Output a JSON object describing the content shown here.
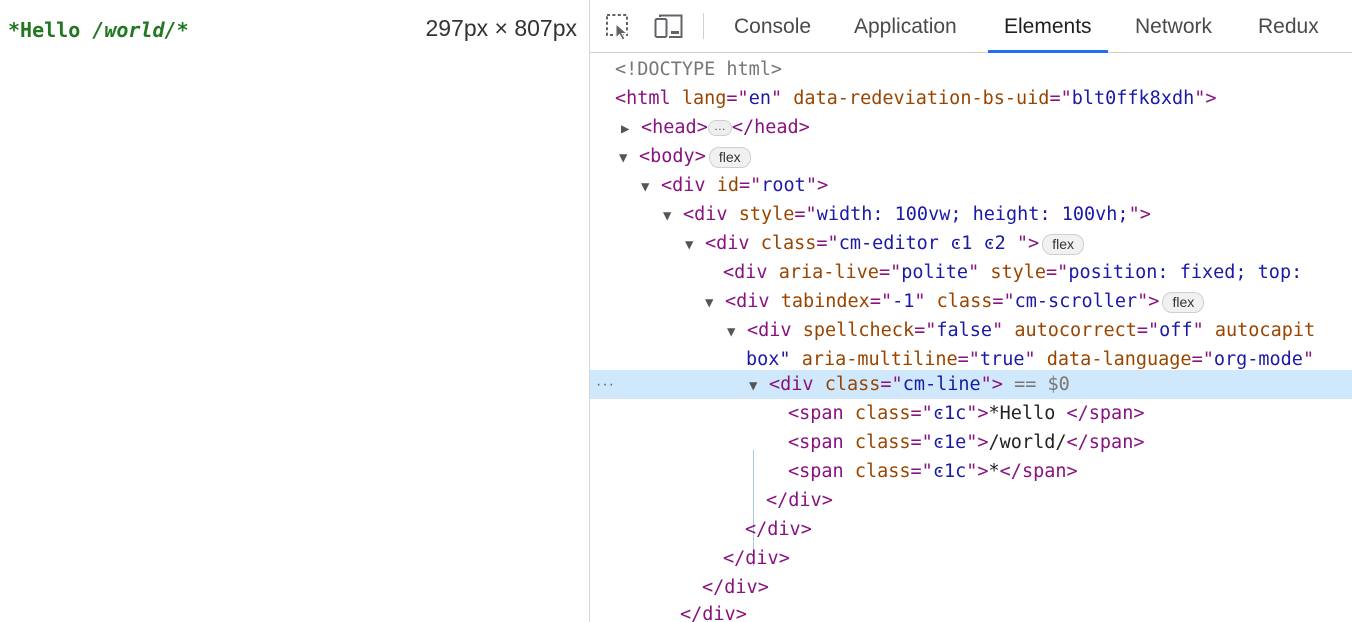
{
  "preview": {
    "editor": {
      "bold_text": "*Hello ",
      "italic_text": "/world/",
      "trailing_text": "*"
    },
    "size_readout": "297px × 807px"
  },
  "devtools": {
    "toolbar": {
      "icons": [
        "inspect-element-icon",
        "device-toolbar-icon"
      ],
      "tabs": [
        "Console",
        "Application",
        "Elements",
        "Network",
        "Redux"
      ],
      "active_tab": "Elements"
    },
    "badges": {
      "flex": "flex",
      "ellipsis": "…"
    },
    "selected_marker": "== $0",
    "row_menu": "···",
    "rows": {
      "doctype": "<!DOCTYPE html>",
      "html_lang": "en",
      "html_uid": "blt0ffk8xdh",
      "root_id": "root",
      "style_full": "width: 100vw; height: 100vh;",
      "editor_class": "cm-editor ͼ1 ͼ2 ",
      "aria_live": "polite",
      "aria_style": "position: fixed; top:",
      "tabindex": "-1",
      "scroller_class": "cm-scroller",
      "spellcheck": "false",
      "autocorrect": "off",
      "autocapit": "autocapit",
      "box_text": "box\"",
      "aria_multiline": "true",
      "data_language": "org-mode",
      "line_class": "cm-line",
      "span1_class": "ͼ1c",
      "span1_text": "*Hello ",
      "span2_class": "ͼ1e",
      "span2_text": "/world/",
      "span3_class": "ͼ1c",
      "span3_text": "*"
    }
  }
}
